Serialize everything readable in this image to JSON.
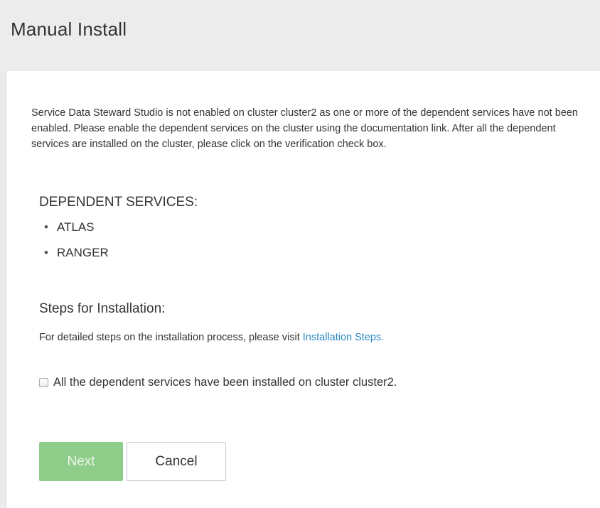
{
  "page": {
    "title": "Manual Install"
  },
  "description": "Service Data Steward Studio is not enabled on cluster cluster2 as one or more of the dependent services have not been enabled. Please enable the dependent services on the cluster using the documentation link. After all the dependent services are installed on the cluster, please click on the verification check box.",
  "dependent_services": {
    "heading": "DEPENDENT SERVICES:",
    "items": [
      "ATLAS",
      "RANGER"
    ]
  },
  "steps": {
    "heading": "Steps for Installation:",
    "text": "For detailed steps on the installation process, please visit ",
    "link_label": "Installation Steps."
  },
  "verification": {
    "label": "All the dependent services have been installed on cluster cluster2.",
    "checked": false
  },
  "buttons": {
    "next_label": "Next",
    "cancel_label": "Cancel"
  },
  "colors": {
    "link": "#2a8bc6",
    "next_button_bg": "#8fce8a",
    "header_bg": "#ececec"
  }
}
